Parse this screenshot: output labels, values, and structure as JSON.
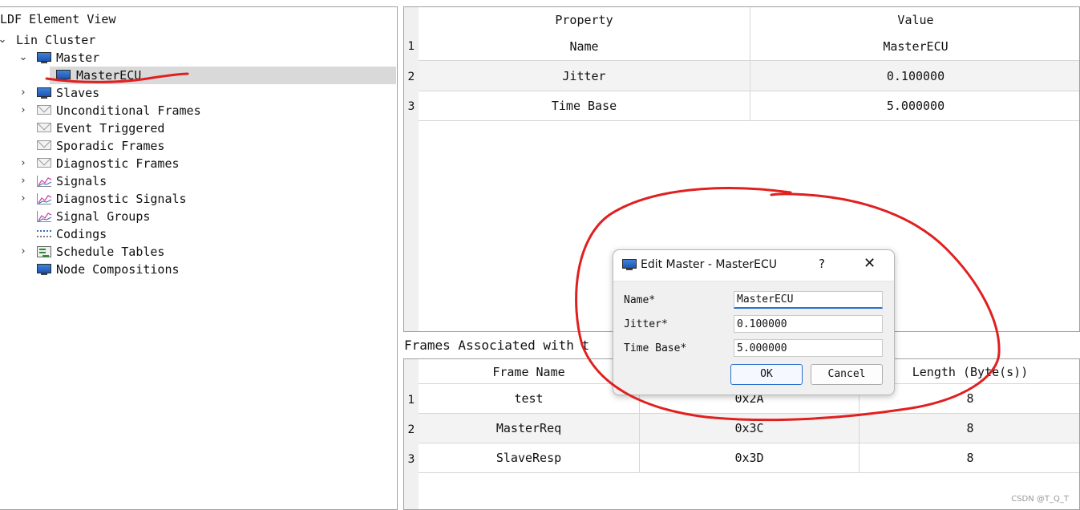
{
  "tree": {
    "title": "LDF Element View",
    "items": [
      {
        "label": "Lin Cluster",
        "chevron": "expanded",
        "icon": "none"
      },
      {
        "label": "Master",
        "chevron": "expanded",
        "icon": "monitor-icon"
      },
      {
        "label": "MasterECU",
        "chevron": "none",
        "icon": "monitor-icon",
        "selected": true
      },
      {
        "label": "Slaves",
        "chevron": "collapsed",
        "icon": "monitor-icon"
      },
      {
        "label": "Unconditional Frames",
        "chevron": "collapsed",
        "icon": "envelope-icon"
      },
      {
        "label": "Event Triggered",
        "chevron": "none",
        "icon": "envelope-icon"
      },
      {
        "label": "Sporadic Frames",
        "chevron": "none",
        "icon": "envelope-icon"
      },
      {
        "label": "Diagnostic Frames",
        "chevron": "collapsed",
        "icon": "envelope-icon"
      },
      {
        "label": "Signals",
        "chevron": "collapsed",
        "icon": "signal-icon"
      },
      {
        "label": "Diagnostic Signals",
        "chevron": "collapsed",
        "icon": "signal-icon"
      },
      {
        "label": "Signal Groups",
        "chevron": "none",
        "icon": "signal-icon"
      },
      {
        "label": "Codings",
        "chevron": "none",
        "icon": "coding-icon"
      },
      {
        "label": "Schedule Tables",
        "chevron": "collapsed",
        "icon": "schedule-icon"
      },
      {
        "label": "Node Compositions",
        "chevron": "none",
        "icon": "monitor-icon"
      }
    ]
  },
  "properties": {
    "headers": [
      "Property",
      "Value"
    ],
    "rows": [
      {
        "num": "1",
        "property": "Name",
        "value": "MasterECU"
      },
      {
        "num": "2",
        "property": "Jitter",
        "value": "0.100000"
      },
      {
        "num": "3",
        "property": "Time Base",
        "value": "5.000000"
      }
    ]
  },
  "frames": {
    "label": "Frames Associated with t",
    "headers": [
      "Frame Name",
      "",
      "Length (Byte(s))"
    ],
    "rows": [
      {
        "num": "1",
        "name": "test",
        "id": "0x2A",
        "length": "8"
      },
      {
        "num": "2",
        "name": "MasterReq",
        "id": "0x3C",
        "length": "8"
      },
      {
        "num": "3",
        "name": "SlaveResp",
        "id": "0x3D",
        "length": "8"
      }
    ]
  },
  "dialog": {
    "title": "Edit Master - MasterECU",
    "help": "?",
    "close": "✕",
    "fields": [
      {
        "label": "Name*",
        "value": "MasterECU"
      },
      {
        "label": "Jitter*",
        "value": "0.100000"
      },
      {
        "label": "Time Base*",
        "value": "5.000000"
      }
    ],
    "ok": "OK",
    "cancel": "Cancel"
  },
  "annotation_color": "#e02020",
  "watermark": "CSDN @T_Q_T"
}
